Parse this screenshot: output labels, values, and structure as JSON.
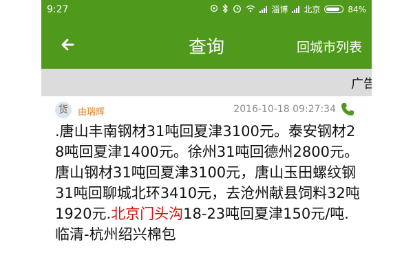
{
  "status_bar": {
    "time": "9:27",
    "carrier_1": "淄博",
    "carrier_2": "北京",
    "battery": "84%",
    "icons": [
      "hotspot-icon",
      "bluetooth-icon",
      "alarm-icon",
      "wifi-icon",
      "signal-icon",
      "battery-icon"
    ]
  },
  "app_bar": {
    "back_icon": "back-arrow-icon",
    "title": "查询",
    "city_list_label": "回城市列表"
  },
  "ad_bar": {
    "text": "广告"
  },
  "post": {
    "avatar_char": "货",
    "poster": "由瑞辉",
    "time": "2016-10-18 09:27:34",
    "call_icon": "phone-icon",
    "body_before_highlight": ".唐山丰南钢材31吨回夏津3100元。泰安钢材28吨回夏津1400元。徐州31吨回德州2800元。唐山钢材31吨回夏津3100元，唐山玉田螺纹钢31吨回聊城北环3410元，去沧州献县饲料32吨1920元.",
    "body_highlight": "北京门头沟",
    "body_after_highlight": "18-23吨回夏津150元/吨.临清-杭州绍兴棉包"
  },
  "colors": {
    "brand_green": "#4f9a1d",
    "ad_background": "#dcdcdc",
    "poster_name": "#e1842b",
    "timestamp": "#8c8c8c",
    "highlight_red": "#d60f0f"
  }
}
